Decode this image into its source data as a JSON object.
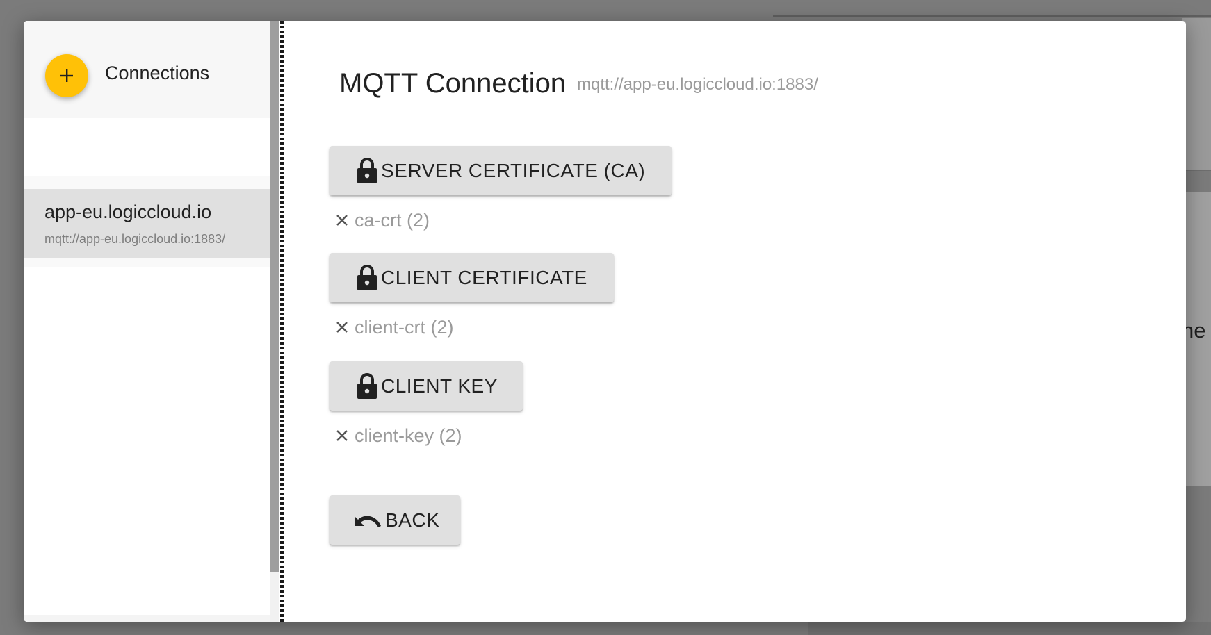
{
  "background": {
    "partial_text": "ne"
  },
  "sidebar": {
    "add_button_icon": "plus-icon",
    "title": "Connections",
    "connections": [
      {
        "name": "app-eu.logiccloud.io",
        "url": "mqtt://app-eu.logiccloud.io:1883/",
        "selected": true
      }
    ]
  },
  "main": {
    "title": "MQTT Connection",
    "url": "mqtt://app-eu.logiccloud.io:1883/",
    "certificates": [
      {
        "button_label": "SERVER CERTIFICATE (CA)",
        "icon": "lock-icon",
        "file": "ca-crt (2)"
      },
      {
        "button_label": "CLIENT CERTIFICATE",
        "icon": "lock-icon",
        "file": "client-crt (2)"
      },
      {
        "button_label": "CLIENT KEY",
        "icon": "lock-icon",
        "file": "client-key (2)"
      }
    ],
    "back_label": "BACK",
    "back_icon": "undo-icon"
  },
  "colors": {
    "accent": "#ffc107",
    "button_bg": "#e0e0e0",
    "selected_item_bg": "#e0e0e0",
    "overlay": "#7b7b7b"
  }
}
